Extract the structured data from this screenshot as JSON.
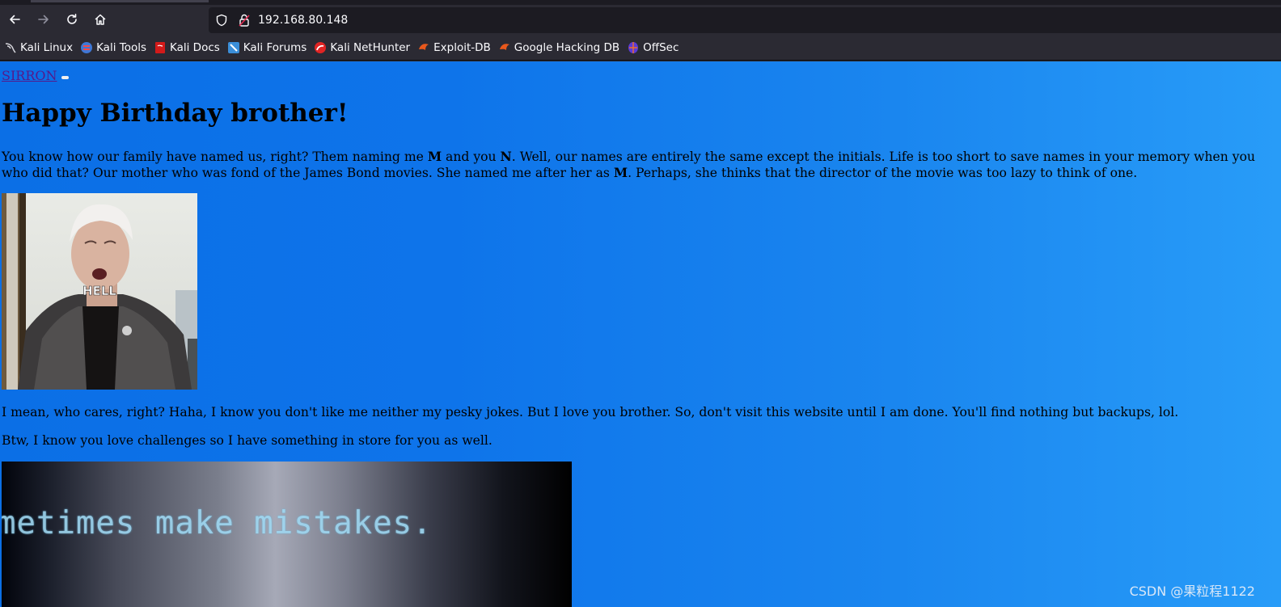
{
  "browser": {
    "url": "192.168.80.148",
    "bookmarks": [
      {
        "label": "Kali Linux",
        "icon": "kali-dragon-icon"
      },
      {
        "label": "Kali Tools",
        "icon": "kali-tools-icon"
      },
      {
        "label": "Kali Docs",
        "icon": "kali-docs-icon"
      },
      {
        "label": "Kali Forums",
        "icon": "kali-forums-icon"
      },
      {
        "label": "Kali NetHunter",
        "icon": "kali-nethunter-icon"
      },
      {
        "label": "Exploit-DB",
        "icon": "exploit-db-icon"
      },
      {
        "label": "Google Hacking DB",
        "icon": "ghdb-icon"
      },
      {
        "label": "OffSec",
        "icon": "offsec-icon"
      }
    ]
  },
  "page": {
    "nav_link": "SIRRON",
    "heading": "Happy Birthday brother!",
    "para1": {
      "line1_a": "You know how our family have named us, right? Them naming me ",
      "line1_b1": "M",
      "line1_c": " and you ",
      "line1_b2": "N",
      "line1_d": ". Well, our names are entirely the same except the initials. Life is too short to save names in your memory when you",
      "line2_a": "who did that? Our mother who was fond of the James Bond movies. She named me after her as ",
      "line2_b": "M",
      "line2_c": ". Perhaps, she thinks that the director of the movie was too lazy to think of one."
    },
    "image1_caption": "HELL",
    "para2": "I mean, who cares, right? Haha, I know you don't like me neither my pesky jokes. But I love you brother. So, don't visit this website until I am done. You'll find nothing but backups, lol.",
    "para3": "Btw, I know you love challenges so I have something in store for you as well.",
    "image2_text": "metimes make mistakes."
  },
  "watermark": "CSDN @果粒程1122",
  "colors": {
    "page_gradient_start": "#0b6fe6",
    "page_gradient_end": "#289cf8",
    "visited_link": "#551a8b",
    "chrome_bg": "#2b2a33"
  }
}
